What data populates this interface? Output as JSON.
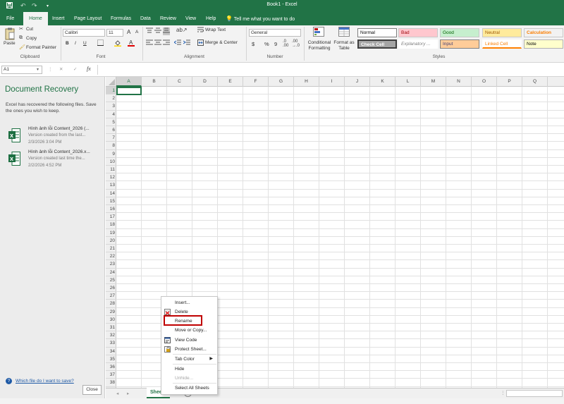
{
  "window": {
    "title": "Book1 - Excel",
    "quick_access": [
      "save-icon",
      "undo-icon",
      "redo-icon",
      "customize-icon"
    ]
  },
  "ribbon_tabs": [
    "File",
    "Home",
    "Insert",
    "Page Layout",
    "Formulas",
    "Data",
    "Review",
    "View",
    "Help"
  ],
  "active_tab": "Home",
  "tell_me": "Tell me what you want to do",
  "clipboard": {
    "paste": "Paste",
    "cut": "Cut",
    "copy": "Copy",
    "format_painter": "Format Painter",
    "label": "Clipboard"
  },
  "font": {
    "name": "Calibri",
    "size": "11",
    "label": "Font",
    "bold": "B",
    "italic": "I",
    "underline": "U",
    "grow": "A",
    "shrink": "A"
  },
  "alignment": {
    "wrap_text": "Wrap Text",
    "merge_center": "Merge & Center",
    "label": "Alignment"
  },
  "number": {
    "format": "General",
    "currency": "$",
    "percent": "%",
    "comma": "9",
    "label": "Number"
  },
  "styles": {
    "conditional_formatting": "Conditional Formatting",
    "format_as_table": "Format as Table",
    "label": "Styles",
    "cells": [
      {
        "name": "Normal",
        "bg": "#ffffff",
        "fg": "#000000"
      },
      {
        "name": "Bad",
        "bg": "#ffc7ce",
        "fg": "#9c0006"
      },
      {
        "name": "Good",
        "bg": "#c6efce",
        "fg": "#006100"
      },
      {
        "name": "Neutral",
        "bg": "#ffeb9c",
        "fg": "#9c5700"
      },
      {
        "name": "Calculation",
        "bg": "#f2f2f2",
        "fg": "#fa7d00"
      },
      {
        "name": "Check Cell",
        "bg": "#a5a5a5",
        "fg": "#ffffff"
      },
      {
        "name": "Explanatory ...",
        "bg": "#ffffff",
        "fg": "#7f7f7f"
      },
      {
        "name": "Input",
        "bg": "#ffcc99",
        "fg": "#3f3f76"
      },
      {
        "name": "Linked Cell",
        "bg": "#ffffff",
        "fg": "#fa7d00"
      },
      {
        "name": "Note",
        "bg": "#ffffcc",
        "fg": "#000000"
      }
    ]
  },
  "formula_bar": {
    "name_box": "A1",
    "cancel": "✕",
    "enter": "✓",
    "fx": "fx",
    "value": ""
  },
  "recovery": {
    "title": "Document Recovery",
    "description": "Excel has recovered the following files. Save the ones you wish to keep.",
    "files": [
      {
        "name": "Hình ảnh lỗi Content_2026 (...",
        "version": "Version created from the last...",
        "date": "2/3/2026 3:04 PM"
      },
      {
        "name": "Hình ảnh lỗi Content_2026.x...",
        "version": "Version created last time the...",
        "date": "2/2/2026 4:52 PM"
      }
    ],
    "help_link": "Which file do I want to save?",
    "close": "Close"
  },
  "grid": {
    "columns": [
      "A",
      "B",
      "C",
      "D",
      "E",
      "F",
      "G",
      "H",
      "I",
      "J",
      "K",
      "L",
      "M",
      "N",
      "O",
      "P",
      "Q"
    ],
    "rows": [
      "1",
      "2",
      "3",
      "4",
      "5",
      "6",
      "7",
      "8",
      "9",
      "10",
      "11",
      "12",
      "13",
      "14",
      "15",
      "16",
      "17",
      "18",
      "19",
      "20",
      "21",
      "22",
      "23",
      "24",
      "25",
      "26",
      "27",
      "28",
      "29",
      "30",
      "31",
      "32",
      "33",
      "34",
      "35",
      "36",
      "37",
      "38"
    ],
    "active_cell": "A1"
  },
  "sheets": {
    "tabs": [
      "Sheet1"
    ],
    "add": "+"
  },
  "context_menu": {
    "items": [
      {
        "label": "Insert...",
        "icon": "",
        "disabled": false
      },
      {
        "label": "Delete",
        "icon": "delete-sheet-icon",
        "disabled": false
      },
      {
        "label": "Rename",
        "icon": "",
        "disabled": false,
        "highlighted": true
      },
      {
        "label": "Move or Copy...",
        "icon": "",
        "disabled": false
      },
      {
        "label": "View Code",
        "icon": "view-code-icon",
        "disabled": false
      },
      {
        "label": "Protect Sheet...",
        "icon": "protect-sheet-icon",
        "disabled": false
      },
      {
        "label": "Tab Color",
        "icon": "",
        "disabled": false,
        "submenu": true
      },
      {
        "label": "Hide",
        "icon": "",
        "disabled": false
      },
      {
        "label": "Unhide...",
        "icon": "",
        "disabled": true
      },
      {
        "label": "Select All Sheets",
        "icon": "",
        "disabled": false
      }
    ]
  }
}
